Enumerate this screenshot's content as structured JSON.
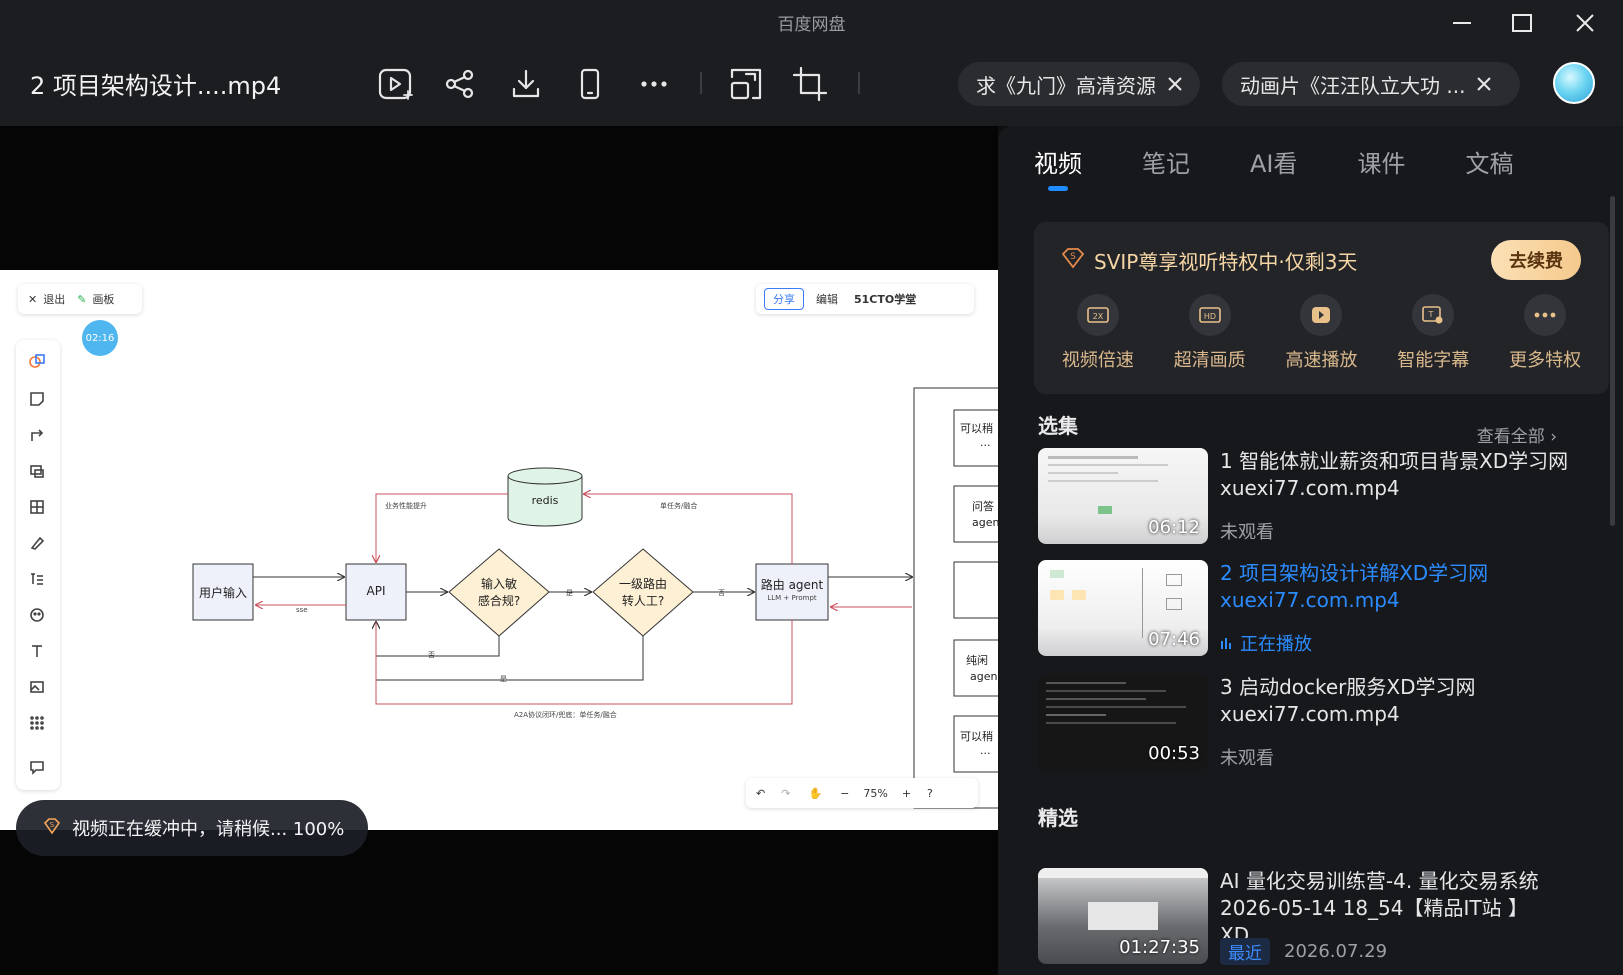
{
  "window": {
    "app_title": "百度网盘",
    "file_title": "2 项目架构设计....mp4"
  },
  "toolbar_icons": [
    "play-add-icon",
    "share-icon",
    "download-icon",
    "phone-icon",
    "more-icon",
    "picture-in-picture-icon",
    "crop-icon"
  ],
  "search_tabs": [
    {
      "label": "求《九门》高清资源"
    },
    {
      "label": "动画片《汪汪队立大功 ..."
    }
  ],
  "video": {
    "buffer_text": "视频正在缓冲中，请稍候... 100%",
    "whiteboard": {
      "exit_label": "退出",
      "board_label": "画板",
      "timer": "02:16",
      "share_label": "分享",
      "edit_label": "编辑",
      "brand_label": "51CTO学堂",
      "zoom": "75%",
      "nodes": {
        "user_input": "用户输入",
        "api": "API",
        "redis": "redis",
        "sensitive_line1": "输入敏",
        "sensitive_line2": "感合规?",
        "route_line1": "一级路由",
        "route_line2": "转人工?",
        "router_line1": "路由 agent",
        "router_line2": "LLM + Prompt",
        "side_1": "可以稍",
        "side_1b": "...",
        "side_2": "问答",
        "side_2b": "agen",
        "side_3": "纯闲",
        "side_3b": "agen",
        "side_4": "可以稍",
        "side_4b": "..."
      },
      "edge_labels": {
        "perf": "业务性能提升",
        "single": "单任务/融合",
        "sse": "sse",
        "yes1": "是",
        "yes2": "否",
        "no1": "否",
        "no2": "是",
        "bottom": "A2A协议闭环/兜底：单任务/融合"
      }
    }
  },
  "panel": {
    "tabs": [
      {
        "label": "视频",
        "active": true
      },
      {
        "label": "笔记",
        "active": false
      },
      {
        "label": "AI看",
        "active": false
      },
      {
        "label": "课件",
        "active": false
      },
      {
        "label": "文稿",
        "active": false
      }
    ],
    "svip": {
      "title": "SVIP尊享视听特权中·仅剩3天",
      "renew_label": "去续费",
      "perks": [
        {
          "label": "视频倍速",
          "icon": "speed-2x-icon"
        },
        {
          "label": "超清画质",
          "icon": "hd-icon"
        },
        {
          "label": "高速播放",
          "icon": "fast-play-icon"
        },
        {
          "label": "智能字幕",
          "icon": "subtitle-icon"
        },
        {
          "label": "更多特权",
          "icon": "more-icon"
        }
      ]
    },
    "episodes_title": "选集",
    "see_all": "查看全部",
    "episodes": [
      {
        "title": "1 智能体就业薪资和项目背景XD学习网 xuexi77.com.mp4",
        "duration": "06:12",
        "status": "未观看",
        "playing": false
      },
      {
        "title": "2 项目架构设计详解XD学习网 xuexi77.com.mp4",
        "duration": "07:46",
        "status": "正在播放",
        "playing": true
      },
      {
        "title": "3 启动docker服务XD学习网 xuexi77.com.mp4",
        "duration": "00:53",
        "status": "未观看",
        "playing": false
      }
    ],
    "featured_title": "精选",
    "featured": {
      "title": "AI 量化交易训练营-4. 量化交易系统 2026-05-14 18_54【精品IT站 】XD...",
      "duration": "01:27:35",
      "tag": "最近",
      "date": "2026.07.29"
    }
  },
  "colors": {
    "accent": "#1e8bff",
    "gold": "#f6d6a5",
    "bg": "#17181b"
  }
}
